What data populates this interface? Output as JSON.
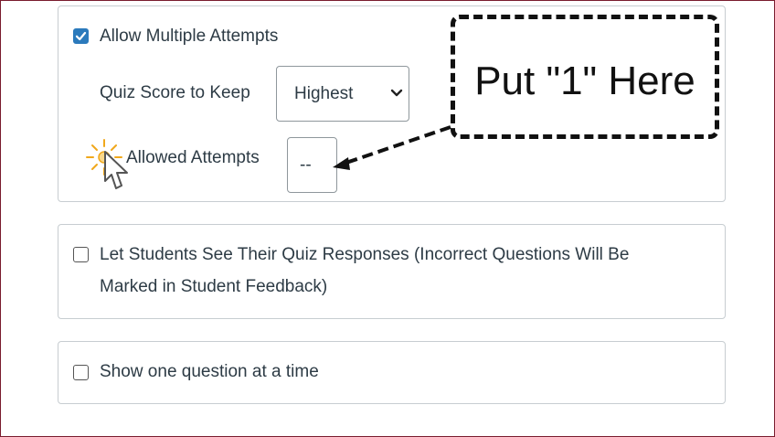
{
  "quiz_options": {
    "allow_multiple_attempts": {
      "label": "Allow Multiple Attempts",
      "checked": true
    },
    "score_to_keep": {
      "label": "Quiz Score to Keep",
      "selected": "Highest"
    },
    "allowed_attempts": {
      "label": "Allowed Attempts",
      "value": "--"
    },
    "see_responses": {
      "label": "Let Students See Their Quiz Responses (Incorrect Questions Will Be Marked in Student Feedback)",
      "checked": false
    },
    "one_question": {
      "label": "Show one question at a time",
      "checked": false
    }
  },
  "annotation": {
    "callout_text": "Put \"1\" Here"
  },
  "colors": {
    "checkbox_accent": "#2b7abc",
    "frame_border": "#7a1c2e",
    "cursor_highlight": "#f0a81c"
  },
  "icons": [
    "checkmark-icon",
    "chevron-down-icon",
    "mouse-cursor-icon",
    "arrow-icon"
  ]
}
